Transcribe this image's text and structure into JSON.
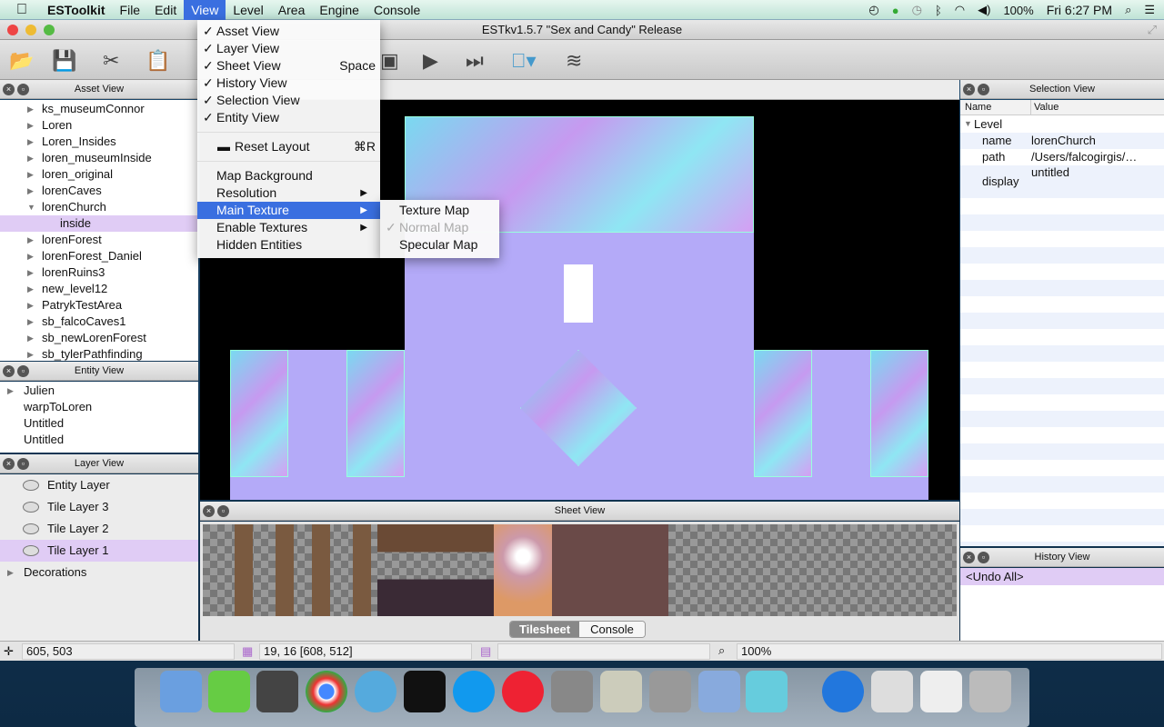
{
  "menubar": {
    "app": "ESToolkit",
    "items": [
      "File",
      "Edit",
      "View",
      "Level",
      "Area",
      "Engine",
      "Console"
    ],
    "battery": "100%",
    "clock": "Fri 6:27 PM"
  },
  "window": {
    "title": "ESTkv1.5.7 \"Sex and Candy\" Release"
  },
  "view_menu": {
    "items": [
      {
        "label": "Asset View",
        "checked": true,
        "shortcut": ""
      },
      {
        "label": "Layer View",
        "checked": true,
        "shortcut": ""
      },
      {
        "label": "Sheet View",
        "checked": true,
        "shortcut": "Space"
      },
      {
        "label": "History View",
        "checked": true,
        "shortcut": ""
      },
      {
        "label": "Selection View",
        "checked": true,
        "shortcut": ""
      },
      {
        "label": "Entity View",
        "checked": true,
        "shortcut": ""
      }
    ],
    "reset_layout": "Reset Layout",
    "reset_shortcut": "⌘R",
    "map_background": "Map Background",
    "resolution": "Resolution",
    "main_texture": "Main Texture",
    "enable_textures": "Enable Textures",
    "hidden_entities": "Hidden Entities"
  },
  "texture_submenu": {
    "items": [
      "Texture Map",
      "Normal Map",
      "Specular Map"
    ],
    "checked": "Normal Map"
  },
  "asset_view": {
    "title": "Asset View",
    "items": [
      "ks_museumConnor",
      "Loren",
      "Loren_Insides",
      "loren_museumInside",
      "loren_original",
      "lorenCaves",
      "lorenChurch",
      "inside",
      "lorenForest",
      "lorenForest_Daniel",
      "lorenRuins3",
      "new_level12",
      "PatrykTestArea",
      "sb_falcoCaves1",
      "sb_newLorenForest",
      "sb_tylerPathfinding"
    ],
    "selected": "inside"
  },
  "entity_view": {
    "title": "Entity View",
    "items": [
      "Julien",
      "warpToLoren",
      "Untitled",
      "Untitled"
    ]
  },
  "layer_view": {
    "title": "Layer View",
    "items": [
      "Entity Layer",
      "Tile Layer 3",
      "Tile Layer 2",
      "Tile Layer 1"
    ],
    "selected": "Tile Layer 1",
    "group": "Decorations"
  },
  "sheet_view": {
    "title": "Sheet View",
    "tabs": [
      "Tilesheet",
      "Console"
    ],
    "active_tab": "Tilesheet"
  },
  "selection_view": {
    "title": "Selection View",
    "columns": [
      "Name",
      "Value"
    ],
    "group": "Level",
    "rows": [
      {
        "name": "name",
        "value": "lorenChurch"
      },
      {
        "name": "path",
        "value": "/Users/falcogirgis/…"
      },
      {
        "name": "display",
        "value": "untitled"
      }
    ]
  },
  "history_view": {
    "title": "History View",
    "items": [
      "<Undo All>"
    ]
  },
  "status": {
    "cursor": "605, 503",
    "tile": "19, 16 [608, 512]",
    "layer": "",
    "zoom": "100%"
  },
  "colors": {
    "accent": "#3a6fe0",
    "selection": "#e0ccf5",
    "canvas_fill": "#b4aaf8"
  }
}
